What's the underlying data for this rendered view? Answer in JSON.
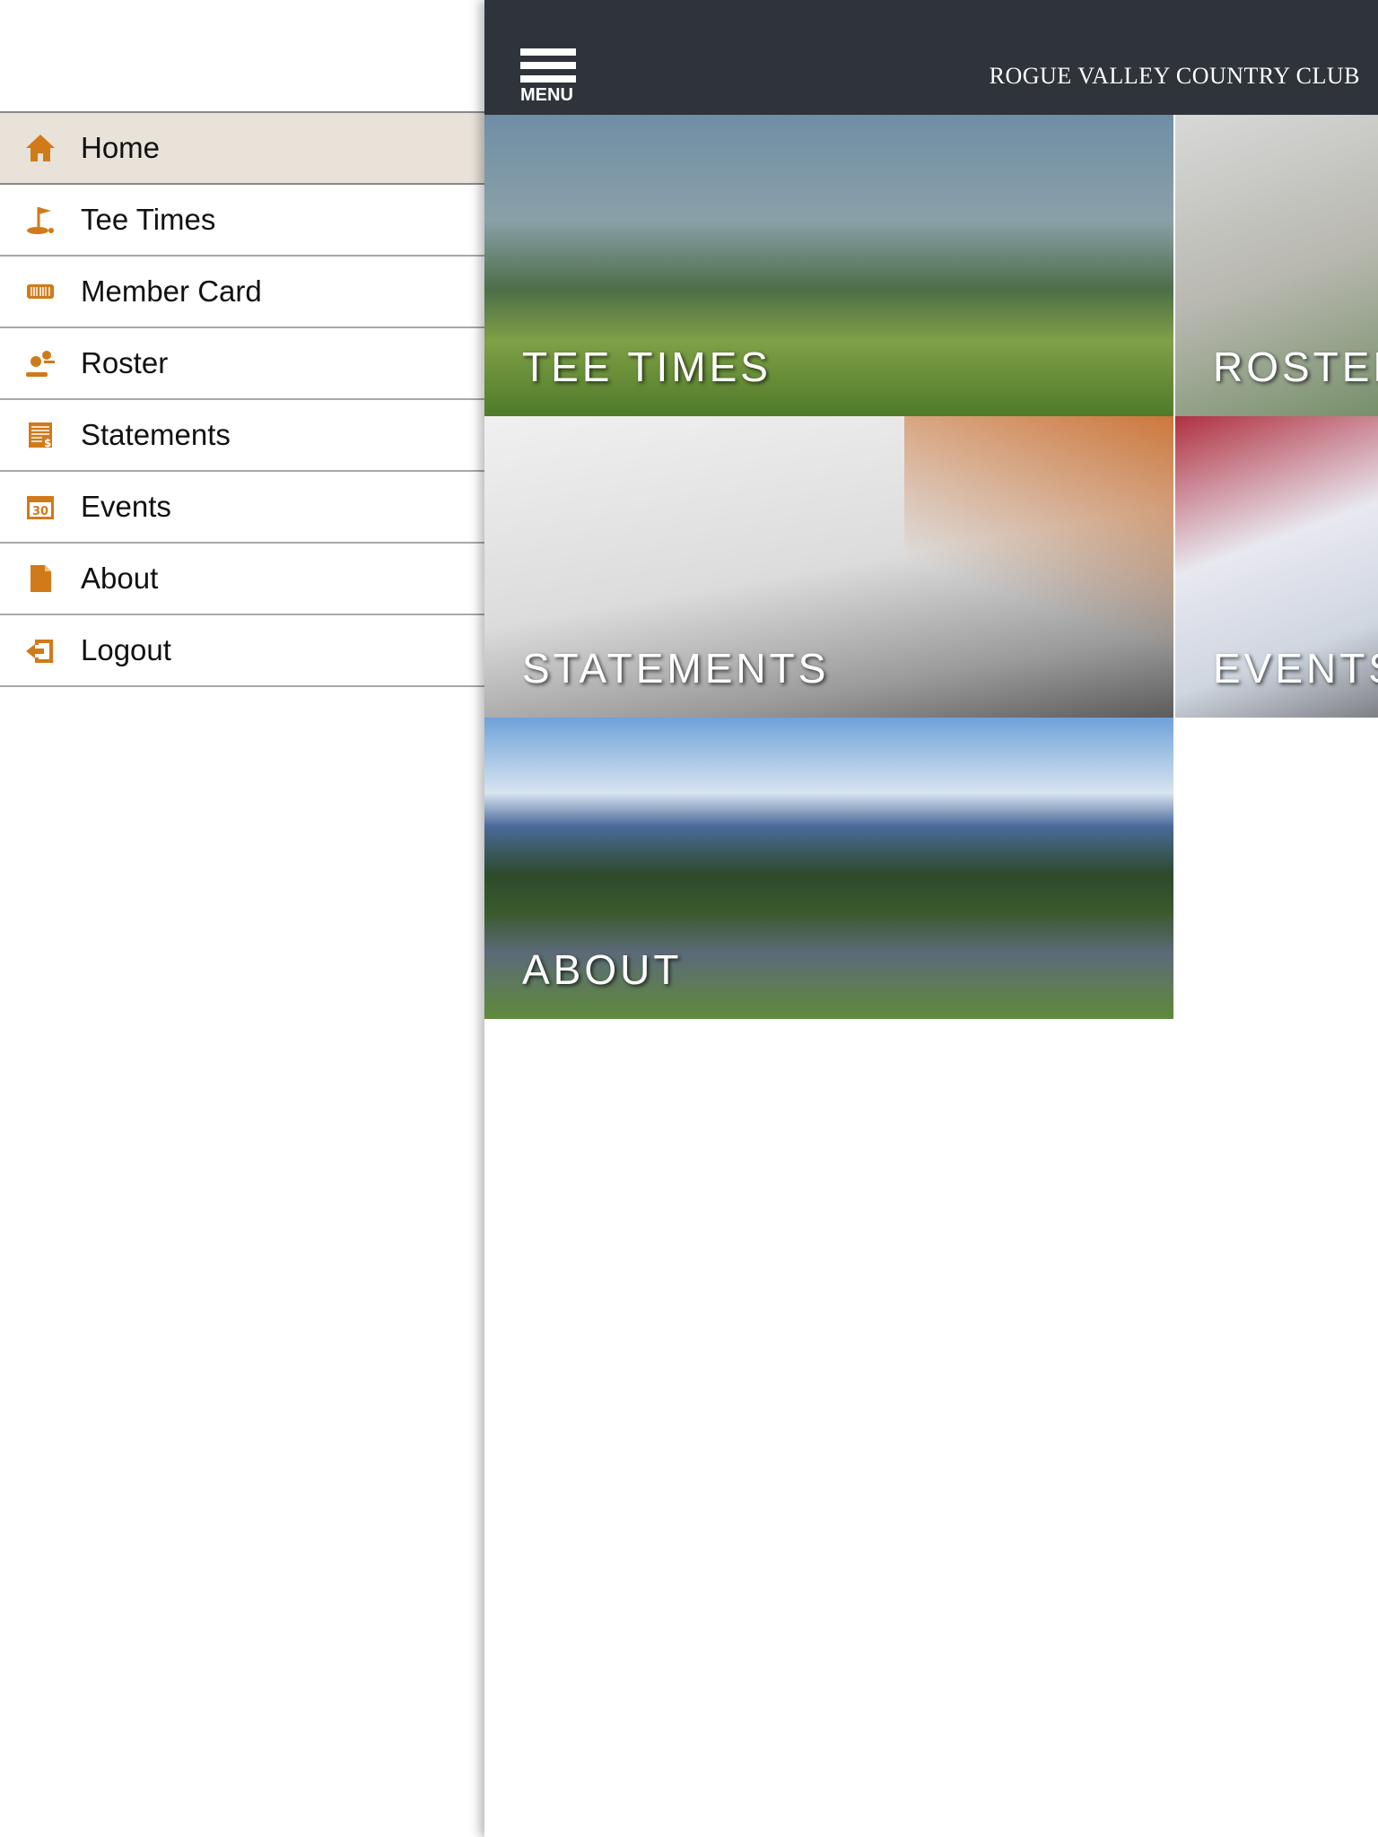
{
  "header": {
    "menu_label": "MENU",
    "title": "ROGUE VALLEY COUNTRY CLUB"
  },
  "accent_color": "#d07a1a",
  "sidebar": {
    "items": [
      {
        "label": "Home",
        "icon": "home-icon",
        "active": true
      },
      {
        "label": "Tee Times",
        "icon": "golf-flag-icon"
      },
      {
        "label": "Member Card",
        "icon": "barcode-card-icon"
      },
      {
        "label": "Roster",
        "icon": "people-icon"
      },
      {
        "label": "Statements",
        "icon": "statement-icon"
      },
      {
        "label": "Events",
        "icon": "calendar-icon"
      },
      {
        "label": "About",
        "icon": "document-icon"
      },
      {
        "label": "Logout",
        "icon": "logout-icon"
      }
    ]
  },
  "tiles": [
    {
      "label": "TEE TIMES"
    },
    {
      "label": "ROSTER"
    },
    {
      "label": "STATEMENTS"
    },
    {
      "label": "EVENTS"
    },
    {
      "label": "ABOUT"
    }
  ],
  "calendar_day": "30"
}
